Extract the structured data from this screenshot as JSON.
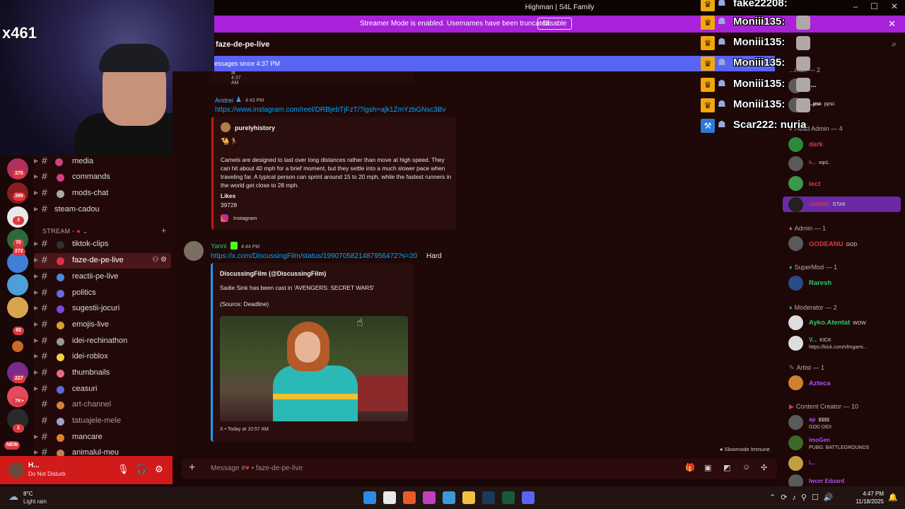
{
  "window": {
    "title": "Highman | S4L Family"
  },
  "banner": {
    "text": "Streamer Mode is enabled. Usernames have been truncated.",
    "button": "Disable"
  },
  "webcam": {
    "overlay_text": "x461"
  },
  "server_badges": [
    "375",
    "399",
    "3",
    "70",
    "272",
    "65",
    "227",
    "7K+",
    "1",
    "NEW"
  ],
  "channels": {
    "items": [
      {
        "label": "media"
      },
      {
        "label": "commands"
      },
      {
        "label": "mods-chat"
      },
      {
        "label": "steam-cadou"
      },
      {
        "label": "tiktok-clips"
      },
      {
        "label": "faze-de-pe-live"
      },
      {
        "label": "reactii-pe-live"
      },
      {
        "label": "politics"
      },
      {
        "label": "sugestii-jocuri"
      },
      {
        "label": "emojis-live"
      },
      {
        "label": "idei-rechinathon"
      },
      {
        "label": "idei-roblox"
      },
      {
        "label": "thumbnails"
      },
      {
        "label": "ceasuri"
      },
      {
        "label": "art-channel"
      },
      {
        "label": "tatuajele-mele"
      },
      {
        "label": "mancare"
      },
      {
        "label": "animalul-meu"
      }
    ],
    "category": "STREAM -"
  },
  "user_panel": {
    "name": "H...",
    "status": "Do Not Disturb"
  },
  "chat": {
    "channel_name": "faze-de-pe-live",
    "new_messages": "essages since 4:37 PM",
    "top_embed_footer": "Today at 4:37 AM",
    "messages": [
      {
        "author": "Andrei",
        "time": "4:43 PM",
        "link": "https://www.instagram.com/reel/DRBjebTjFzT/?igsh=ajk1ZmYzbGNsc3Bv",
        "embed": {
          "author": "purelyhistory",
          "emoji": "🐪🏃",
          "description": "Camels are designed to last over long distances rather than move at high speed. They can hit about 40 mph for a brief moment, but they settle into a much slower pace when traveling far. A typical person can sprint around 15 to 20 mph, while the fastest runners in the world get close to 28 mph.",
          "likes_label": "Likes",
          "likes_value": "39728",
          "provider": "Instagram"
        }
      },
      {
        "author": "Yanni",
        "time": "4:44 PM",
        "link": "https://x.com/DiscussingFilm/status/1990705821487956472?s=20",
        "after_link": "Hard",
        "embed": {
          "title": "DiscussingFilm (@DiscussingFilm)",
          "text": "Sadie Sink has been cast in 'AVENGERS: SECRET WARS'",
          "source": "(Source: Deadline)",
          "footer": "X • Today at 10:57 AM"
        }
      }
    ],
    "slowmode": "Slowmode Immune",
    "composer_placeholder": "Message #",
    "composer_channel": "• faze-de-pe-live"
  },
  "members": {
    "groups": [
      {
        "role": "...man — 2",
        "members": [
          {
            "name": "l...",
            "tag": ""
          },
          {
            "name": "...psc",
            "tag": "ppsc"
          }
        ]
      },
      {
        "role": "Head Admin — 4",
        "members": [
          {
            "name": "dark",
            "tag": ""
          },
          {
            "name": "h...",
            "tag": "xqcL"
          },
          {
            "name": "lect",
            "tag": ""
          },
          {
            "name": "zaSAMY",
            "tag": "GTA6"
          }
        ]
      },
      {
        "role": "Admin — 1",
        "members": [
          {
            "name": "GODEANU",
            "tag": "GOD"
          }
        ]
      },
      {
        "role": "SuperMod — 1",
        "members": [
          {
            "name": "Raresh",
            "tag": ""
          }
        ]
      },
      {
        "role": "Moderator — 2",
        "members": [
          {
            "name": "Ayko.Atentat",
            "tag": "WOW"
          },
          {
            "name": "V...",
            "tag": "KICK",
            "sub": "https://kick.com/vfmgami..."
          }
        ]
      },
      {
        "role": "Artist — 1",
        "members": [
          {
            "name": "Azteca",
            "tag": ""
          }
        ]
      },
      {
        "role": "Content Creator — 10",
        "members": [
          {
            "name": "ap",
            "tag": "$$$$",
            "sub": "GOD DIDI"
          },
          {
            "name": "imoGen",
            "tag": "",
            "sub": "PUBG: BATTLEGROUNDS"
          },
          {
            "name": "i...",
            "tag": ""
          },
          {
            "name": "Iwcer Eduard",
            "tag": ""
          }
        ]
      }
    ]
  },
  "stream_overlay": {
    "rows": [
      {
        "text": "fake22208:"
      },
      {
        "text": "Moniii135:"
      },
      {
        "text": "Moniii135:"
      },
      {
        "text": "Moniii135:"
      },
      {
        "text": "Moniii135:"
      },
      {
        "text": "Moniii135:"
      },
      {
        "text": "Scar222: nuria"
      }
    ]
  },
  "taskbar": {
    "temp": "8°C",
    "condition": "Light rain",
    "time": "4:47 PM",
    "date": "11/18/2025"
  },
  "colors": {
    "banner": "#a722d8",
    "new_bar": "#5865f2",
    "link": "#00a8fc",
    "background": "#1f0808"
  }
}
